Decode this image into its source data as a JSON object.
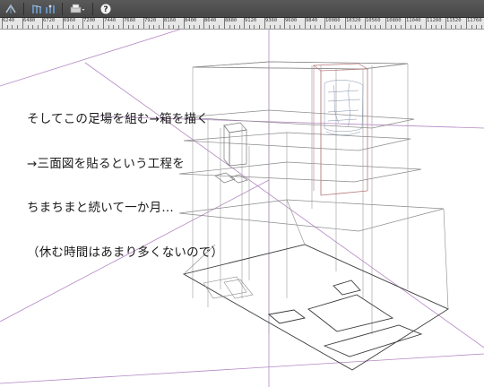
{
  "toolbar": {
    "buttons": [
      {
        "name": "symmetry-ruler-icon",
        "glyph": "✎",
        "color": "#9fb4c9"
      },
      {
        "name": "perspective-ruler-icon",
        "glyph": "⋰",
        "color": "#6fa0d8"
      },
      {
        "name": "ruler-snap-icon",
        "glyph": "⩘",
        "color": "#6fa0d8"
      },
      {
        "name": "print-icon",
        "glyph": "⎙",
        "color": "#d0d0d0"
      },
      {
        "name": "help-icon",
        "glyph": "?",
        "color": "#ffffff"
      }
    ]
  },
  "ruler": {
    "labels": [
      "6240",
      "6480",
      "6720",
      "6960",
      "7200",
      "7440",
      "7680",
      "7920",
      "8160",
      "8400",
      "8640",
      "8880",
      "9120",
      "9360",
      "9600",
      "9840",
      "10080",
      "10320",
      "10560",
      "10800",
      "11040",
      "11280",
      "11520",
      "11760"
    ]
  },
  "caption": {
    "lines": [
      "そしてこの足場を組む→箱を描く",
      "→三面図を貼るという工程を",
      "ちまちまと続いて一か月…",
      "（休む時間はあまり多くないので）"
    ]
  },
  "colors": {
    "guide_purple": "#b488c4",
    "line_gray": "#8a8a8a",
    "line_red": "#b77a7a",
    "line_dark": "#3a3a3a"
  }
}
